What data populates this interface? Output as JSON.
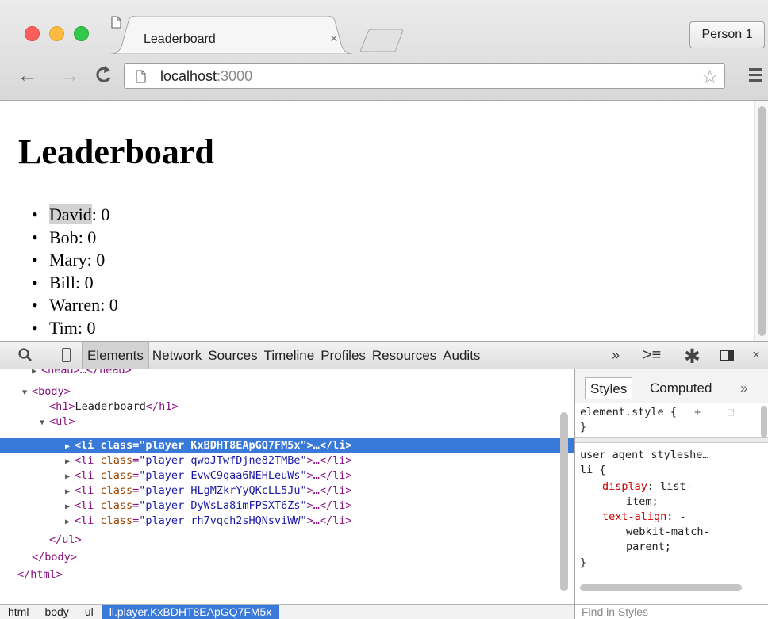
{
  "browser": {
    "tab_title": "Leaderboard",
    "tab_close": "×",
    "profile_button": "Person 1",
    "url": "localhost:3000",
    "url_host": "localhost",
    "url_port": ":3000",
    "icons": [
      "back-arrow-icon",
      "forward-arrow-icon",
      "reload-icon",
      "document-icon",
      "star-icon",
      "hamburger-menu-icon"
    ]
  },
  "page": {
    "title": "Leaderboard",
    "players": [
      {
        "name": "David",
        "score": ": 0"
      },
      {
        "name": "Bob",
        "score": ": 0"
      },
      {
        "name": "Mary",
        "score": ": 0"
      },
      {
        "name": "Bill",
        "score": ": 0"
      },
      {
        "name": "Warren",
        "score": ": 0"
      },
      {
        "name": "Tim",
        "score": ": 0"
      }
    ]
  },
  "devtools": {
    "tabs": [
      "Elements",
      "Network",
      "Sources",
      "Timeline",
      "Profiles",
      "Resources",
      "Audits"
    ],
    "active_tab": "Elements",
    "more": "»",
    "close": "×",
    "tree": {
      "head": "<head>…</head>",
      "body_open": "<body>",
      "h1_open": "<h1>",
      "h1_text": "Leaderboard",
      "h1_close": "</h1>",
      "ul_open": "<ul>",
      "li_open": "<li ",
      "attr_name": "class",
      "attr_eq": "=",
      "li_close": ">…</li>",
      "items": [
        "\"player KxBDHT8EApGQ7FM5x\"",
        "\"player qwbJTwfDjne82TMBe\"",
        "\"player EvwC9qaa6NEHLeuWs\"",
        "\"player HLgMZkrYyQKcLL5Ju\"",
        "\"player DyWsLa8imFPSXT6Zs\"",
        "\"player rh7vqch2sHQNsviWW\""
      ],
      "ul_close": "</ul>",
      "body_close": "</body>",
      "html_close": "</html>"
    },
    "breadcrumbs": [
      "html",
      "body",
      "ul",
      "li.player.KxBDHT8EApGQ7FM5x"
    ],
    "styles": {
      "tab_styles": "Styles",
      "tab_computed": "Computed",
      "more": "»",
      "element_style": "element.style {",
      "element_close": "}",
      "ua_label": "user agent styleshe…",
      "li_selector": "li {",
      "prop1": "display",
      "val1a": ": list-",
      "val1b": "item;",
      "prop2": "text-align",
      "val2a": ": -",
      "val2b": "webkit-match-",
      "val2c": "parent;",
      "rule_close": "}",
      "find_placeholder": "Find in Styles"
    }
  },
  "colors": {
    "selection": "#3879d9",
    "tag": "#881280",
    "attr_name": "#994500",
    "attr_value": "#1a1aa6",
    "css_prop": "#c80000"
  }
}
